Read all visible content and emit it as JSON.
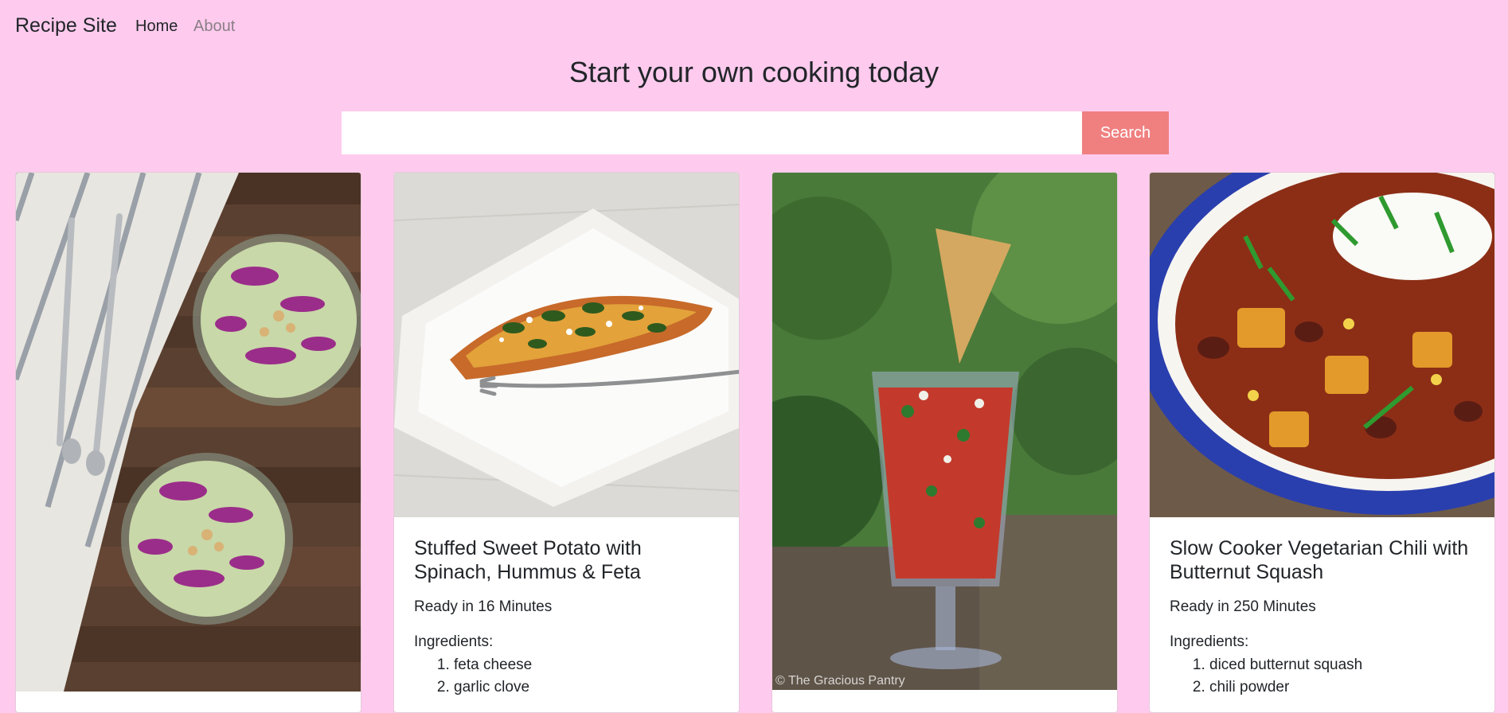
{
  "nav": {
    "brand": "Recipe Site",
    "links": [
      "Home",
      "About"
    ]
  },
  "hero": {
    "title": "Start your own cooking today"
  },
  "search": {
    "value": "",
    "placeholder": "",
    "button_label": "Search"
  },
  "cards": [
    {
      "image_desc": "two bowls of cabbage slaw with forks on wooden table",
      "title": "",
      "ready": "",
      "ingredients_label": "",
      "ingredients": []
    },
    {
      "image_desc": "stuffed sweet potato on white plate with fork",
      "title": "Stuffed Sweet Potato with Spinach, Hummus & Feta",
      "ready": "Ready in 16 Minutes",
      "ingredients_label": "Ingredients:",
      "ingredients": [
        "feta cheese",
        "garlic clove"
      ]
    },
    {
      "image_desc": "salsa in tall glass with tortilla chip",
      "watermark": "© The Gracious Pantry",
      "title": "",
      "ready": "",
      "ingredients_label": "",
      "ingredients": []
    },
    {
      "image_desc": "bowl of vegetarian chili with sour cream and scallions",
      "title": "Slow Cooker Vegetarian Chili with Butternut Squash",
      "ready": "Ready in 250 Minutes",
      "ingredients_label": "Ingredients:",
      "ingredients": [
        "diced butternut squash",
        "chili powder"
      ]
    }
  ],
  "colors": {
    "background": "#fecbee",
    "search_button": "#f08080",
    "text": "#212529",
    "muted_link": "#8a7f86"
  }
}
